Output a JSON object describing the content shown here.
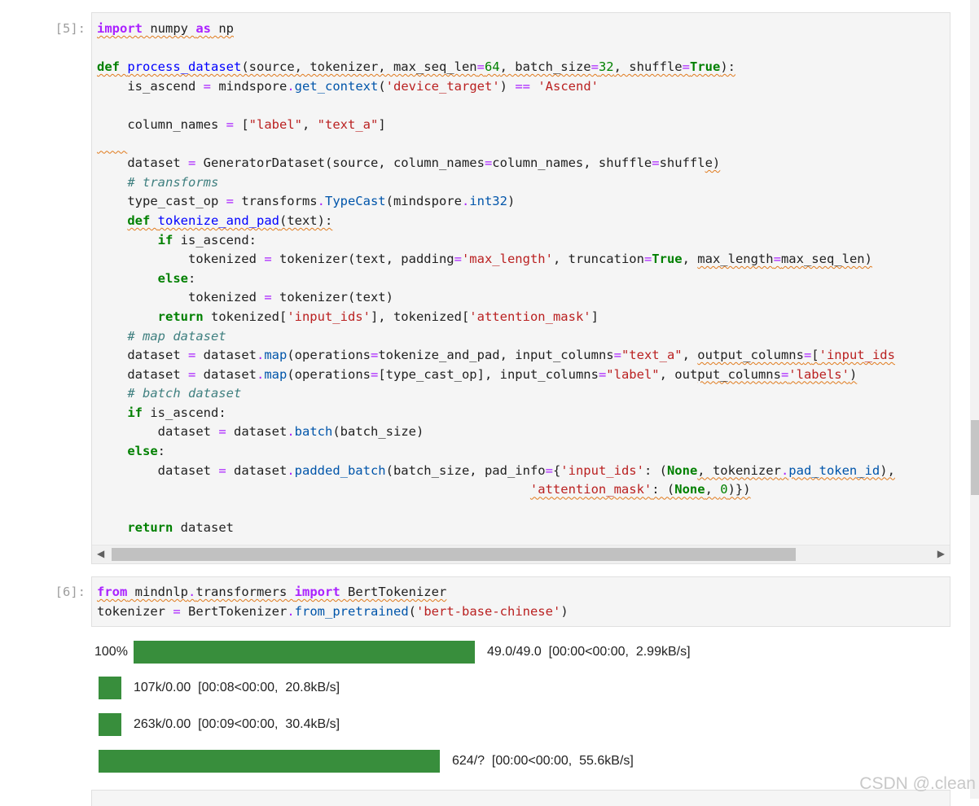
{
  "cell5": {
    "prompt": "[5]:",
    "scroll_left_icon": "triangle-left-icon",
    "scroll_right_icon": "triangle-right-icon"
  },
  "cell6": {
    "prompt": "[6]:"
  },
  "progress": [
    {
      "percent_label": "100%",
      "fill_fraction": 1.0,
      "text": "49.0/49.0  [00:00<00:00,  2.99kB/s]"
    },
    {
      "percent_label": "",
      "fill_fraction": 1.0,
      "text": "107k/0.00  [00:08<00:00,  20.8kB/s]"
    },
    {
      "percent_label": "",
      "fill_fraction": 1.0,
      "text": "263k/0.00  [00:09<00:00,  30.4kB/s]"
    },
    {
      "percent_label": "",
      "fill_fraction": 1.0,
      "text": "624/?  [00:00<00:00,  55.6kB/s]"
    }
  ],
  "progress_color": "#388e3c",
  "watermark": "CSDN @.clean"
}
